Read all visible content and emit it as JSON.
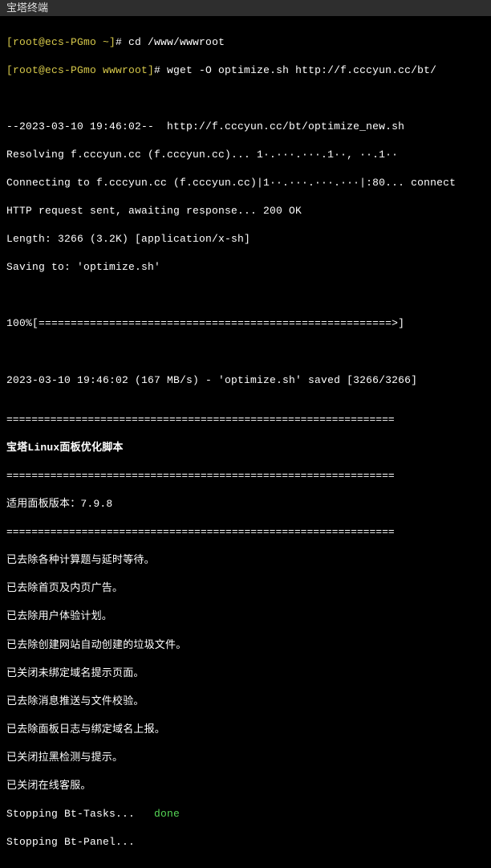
{
  "titlebar": {
    "label": "宝塔终端"
  },
  "prompt1": {
    "userhost": "[root@ecs-PGmo ~]",
    "sep": "# ",
    "cmd": "cd /www/wwwroot"
  },
  "prompt2": {
    "userhost": "[root@ecs-PGmo wwwroot]",
    "sep": "# ",
    "cmd": "wget -O optimize.sh http://f.cccyun.cc/bt/"
  },
  "wget": {
    "ts_line": "--2023-03-10 19:46:02--  http://f.cccyun.cc/bt/optimize_new.sh",
    "resolving": "Resolving f.cccyun.cc (f.cccyun.cc)... 1·.···.···.1··, ··.1··",
    "connecting": "Connecting to f.cccyun.cc (f.cccyun.cc)|1··.···.···.···|:80... connect",
    "http": "HTTP request sent, awaiting response... 200 OK",
    "length": "Length: 3266 (3.2K) [application/x-sh]",
    "saving": "Saving to: 'optimize.sh'",
    "progress": "100%[=======================================================>]",
    "done": "2023-03-10 19:46:02 (167 MB/s) - 'optimize.sh' saved [3266/3266]"
  },
  "script": {
    "hr": "==============================================================",
    "title": "宝塔Linux面板优化脚本",
    "version": "适用面板版本：7.9.8",
    "steps": [
      "已去除各种计算题与延时等待。",
      "已去除首页及内页广告。",
      "已去除用户体验计划。",
      "已去除创建网站自动创建的垃圾文件。",
      "已关闭未绑定域名提示页面。",
      "已去除消息推送与文件校验。",
      "已去除面板日志与绑定域名上报。",
      "已关闭拉黑检测与提示。",
      "已关闭在线客服。"
    ],
    "stop1_label": "Stopping Bt-Tasks...   ",
    "stop1_status": "done",
    "stop2": "Stopping Bt-Panel..."
  }
}
